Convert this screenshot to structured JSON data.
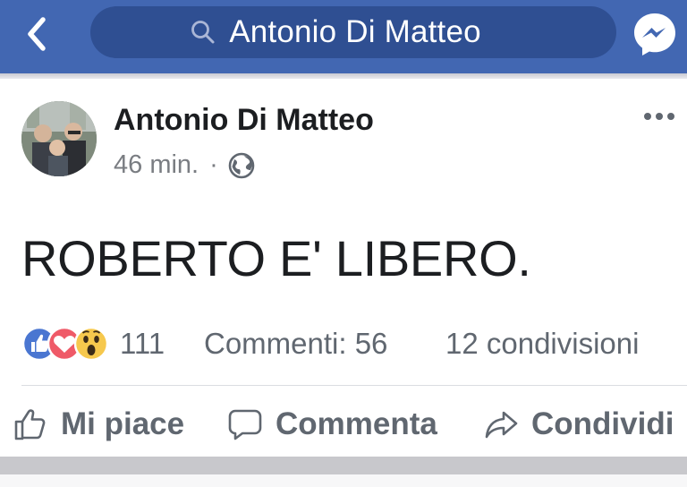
{
  "header": {
    "search_text": "Antonio Di Matteo",
    "back_icon": "chevron-left-icon",
    "search_icon": "search-icon",
    "messenger_icon": "messenger-icon",
    "bar_color": "#4267b2"
  },
  "post": {
    "author": "Antonio Di Matteo",
    "time": "46 min.",
    "separator": "·",
    "privacy_icon": "globe-icon",
    "menu_icon": "more-icon",
    "text": "ROBERTO E' LIBERO.",
    "stats": {
      "reactions": [
        "like",
        "love",
        "wow"
      ],
      "reaction_count": "111",
      "comments": "Commenti: 56",
      "shares": "12 condivisioni"
    },
    "actions": {
      "like": "Mi piace",
      "comment": "Commenta",
      "share": "Condividi"
    }
  }
}
